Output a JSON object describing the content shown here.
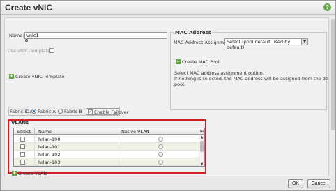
{
  "dialog": {
    "title": "Create vNIC",
    "help_icon": "help-icon"
  },
  "form": {
    "name_label": "Name:",
    "name_value": "vnic1",
    "use_template_label": "Use vNIC Template:",
    "create_template_link": "Create vNIC Template"
  },
  "mac": {
    "section_title": "MAC Address",
    "assignment_label": "MAC Address Assignment:",
    "assignment_value": "Select (pool default used by default)",
    "create_pool_link": "Create MAC Pool",
    "help_line1": "Select MAC address assignment option.",
    "help_line2": "If nothing is selected, the MAC address will be assigned from the default",
    "help_line3": "pool."
  },
  "fabric": {
    "label": "Fabric ID:",
    "option_a": "Fabric A",
    "option_b": "Fabric B",
    "selected": "Fabric A",
    "failover_label": "Enable Failover",
    "failover_checked": true
  },
  "vlans": {
    "title": "VLANs",
    "columns": [
      "Select",
      "Name",
      "Native VLAN"
    ],
    "rows": [
      {
        "name": "hrlan-100"
      },
      {
        "name": "hrlan-101"
      },
      {
        "name": "hrlan-102"
      },
      {
        "name": "hrlan-103"
      }
    ],
    "create_link": "Create VLAN"
  },
  "buttons": {
    "ok": "OK",
    "cancel": "Cancel"
  },
  "colors": {
    "highlight_frame": "#d12020",
    "add_icon": "#5ea33e",
    "help_icon": "#6aa84f"
  }
}
